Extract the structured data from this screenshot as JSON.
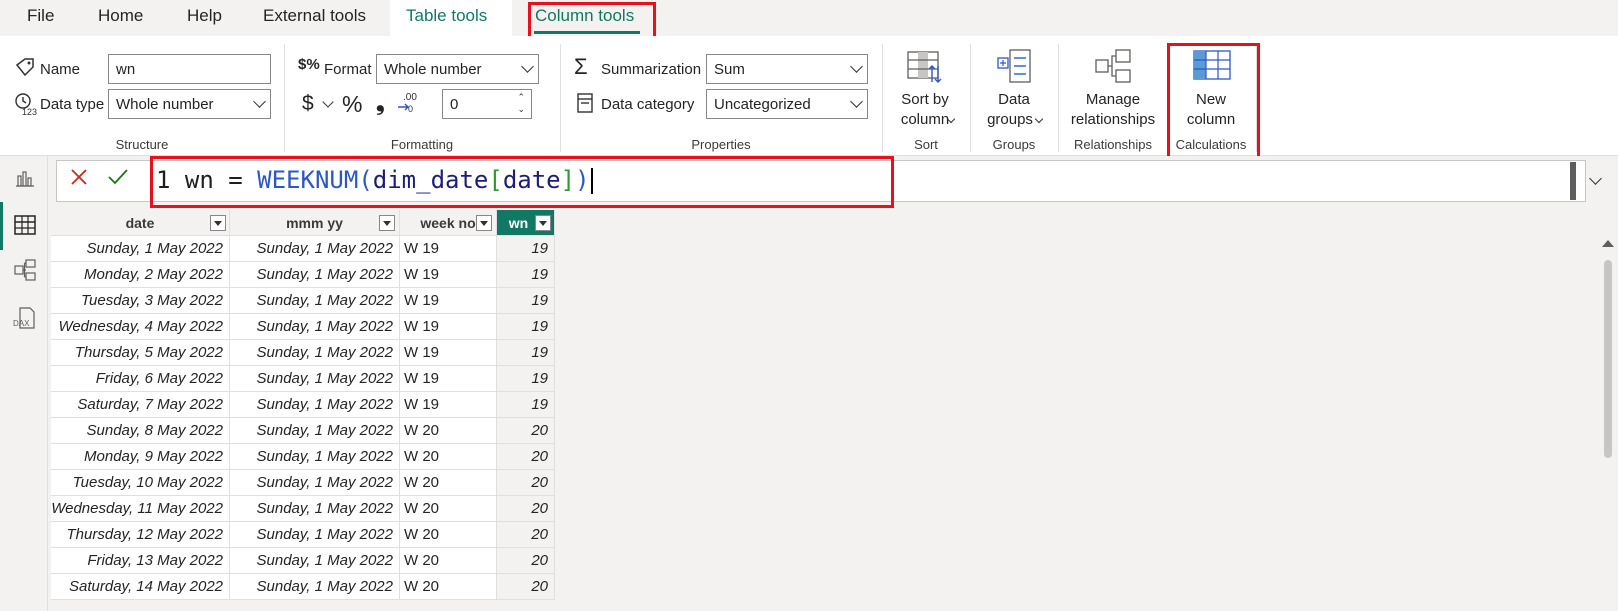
{
  "menu": {
    "file": "File",
    "home": "Home",
    "help": "Help",
    "external_tools": "External tools",
    "table_tools": "Table tools",
    "column_tools": "Column tools"
  },
  "ribbon": {
    "structure": {
      "name_label": "Name",
      "name_value": "wn",
      "data_type_label": "Data type",
      "data_type_value": "Whole number",
      "group_label": "Structure"
    },
    "formatting": {
      "format_label": "Format",
      "format_value": "Whole number",
      "currency_symbol": "$",
      "percent_symbol": "%",
      "comma_symbol": "❟",
      "decimals_value": "0",
      "group_label": "Formatting"
    },
    "properties": {
      "summarization_label": "Summarization",
      "summarization_value": "Sum",
      "data_category_label": "Data category",
      "data_category_value": "Uncategorized",
      "group_label": "Properties"
    },
    "sort": {
      "line1": "Sort by",
      "line2": "column",
      "group_label": "Sort"
    },
    "groups": {
      "line1": "Data",
      "line2": "groups",
      "group_label": "Groups"
    },
    "relationships": {
      "line1": "Manage",
      "line2": "relationships",
      "group_label": "Relationships"
    },
    "calculations": {
      "line1": "New",
      "line2": "column",
      "group_label": "Calculations"
    }
  },
  "formula": {
    "line_no": "1",
    "lhs": "wn = ",
    "fn": "WEEKNUM",
    "open": "(",
    "table": "dim_date",
    "bopen": "[",
    "column": "date",
    "bclose": "]",
    "close": ")"
  },
  "table": {
    "headers": [
      "date",
      "mmm yy",
      "week no",
      "wn"
    ],
    "rows": [
      [
        "Sunday, 1 May 2022",
        "Sunday, 1 May 2022",
        "W 19",
        "19"
      ],
      [
        "Monday, 2 May 2022",
        "Sunday, 1 May 2022",
        "W 19",
        "19"
      ],
      [
        "Tuesday, 3 May 2022",
        "Sunday, 1 May 2022",
        "W 19",
        "19"
      ],
      [
        "Wednesday, 4 May 2022",
        "Sunday, 1 May 2022",
        "W 19",
        "19"
      ],
      [
        "Thursday, 5 May 2022",
        "Sunday, 1 May 2022",
        "W 19",
        "19"
      ],
      [
        "Friday, 6 May 2022",
        "Sunday, 1 May 2022",
        "W 19",
        "19"
      ],
      [
        "Saturday, 7 May 2022",
        "Sunday, 1 May 2022",
        "W 19",
        "19"
      ],
      [
        "Sunday, 8 May 2022",
        "Sunday, 1 May 2022",
        "W 20",
        "20"
      ],
      [
        "Monday, 9 May 2022",
        "Sunday, 1 May 2022",
        "W 20",
        "20"
      ],
      [
        "Tuesday, 10 May 2022",
        "Sunday, 1 May 2022",
        "W 20",
        "20"
      ],
      [
        "Wednesday, 11 May 2022",
        "Sunday, 1 May 2022",
        "W 20",
        "20"
      ],
      [
        "Thursday, 12 May 2022",
        "Sunday, 1 May 2022",
        "W 20",
        "20"
      ],
      [
        "Friday, 13 May 2022",
        "Sunday, 1 May 2022",
        "W 20",
        "20"
      ],
      [
        "Saturday, 14 May 2022",
        "Sunday, 1 May 2022",
        "W 20",
        "20"
      ]
    ]
  },
  "colors": {
    "accent": "#117865",
    "highlight_red": "#e8101d",
    "dax_function": "#2b57c9"
  }
}
